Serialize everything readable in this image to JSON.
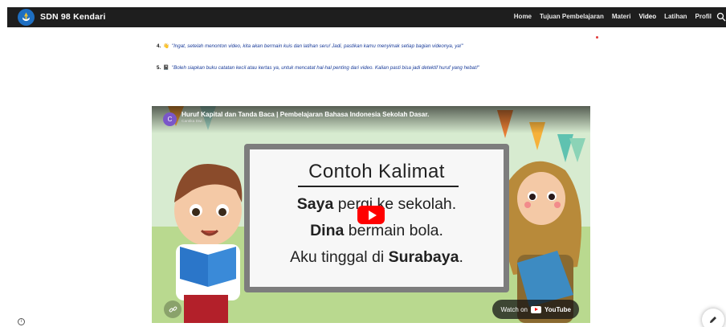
{
  "navbar": {
    "brand": "SDN 98 Kendari",
    "links": [
      {
        "label": "Home"
      },
      {
        "label": "Tujuan Pembelajaran"
      },
      {
        "label": "Materi"
      },
      {
        "label": "Video",
        "active": true
      },
      {
        "label": "Latihan"
      },
      {
        "label": "Profil"
      }
    ],
    "search_icon": "search-icon",
    "logo_icon": "school-logo-icon"
  },
  "content": {
    "items": [
      {
        "number": "4.",
        "emoji": "👋",
        "text": "\"Ingat, setelah menonton video, kita akan bermain kuis dan latihan seru! Jadi, pastikan kamu menyimak setiap bagian videonya, ya!\""
      },
      {
        "number": "5.",
        "emoji": "📓",
        "text": "\"Boleh siapkan buku catatan kecil atau kertas ya, untuk mencatat hal-hal penting dari video. Kalian pasti bisa jadi detektif huruf yang hebat!\""
      }
    ]
  },
  "video": {
    "title": "Huruf Kapital dan Tanda Baca | Pembelajaran Bahasa Indonesia Sekolah Dasar.",
    "channel": "Cantika Dwi",
    "channel_initial": "C",
    "board_heading": "Contoh Kalimat",
    "board_lines": [
      {
        "bold": "Saya",
        "rest": " pergi ke sekolah."
      },
      {
        "bold": "Dina",
        "rest": " bermain bola."
      },
      {
        "prefix": "Aku tinggal di ",
        "bold": "Surabaya",
        "suffix": "."
      }
    ],
    "watch_on": "Watch on",
    "youtube": "YouTube",
    "link_icon": "link-icon",
    "play_icon": "play-icon"
  },
  "footer": {
    "info_icon": "info-icon",
    "edit_icon": "pencil-icon"
  },
  "colors": {
    "navbar_bg": "#1e1e1e",
    "text_blue": "#1b3d9a",
    "youtube_red": "#ff0000"
  }
}
